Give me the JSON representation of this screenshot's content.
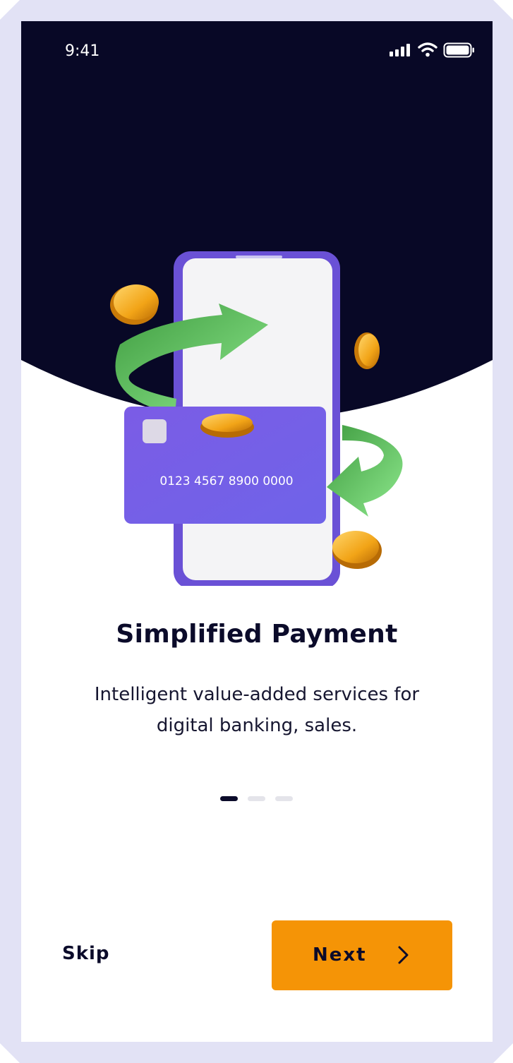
{
  "status_bar": {
    "time": "9:41",
    "icons": [
      "signal-icon",
      "wifi-icon",
      "battery-icon"
    ]
  },
  "illustration": {
    "card_number": "0123 4567 8900 0000",
    "icons": [
      "phone",
      "credit-card",
      "coin",
      "arrow-icon"
    ]
  },
  "onboarding": {
    "title": "Simplified Payment",
    "subtitle_line1": "Intelligent value-added services for",
    "subtitle_line2": "digital banking, sales.",
    "page_count": 3,
    "current_page": 1
  },
  "actions": {
    "skip_label": "Skip",
    "next_label": "Next",
    "next_icon": "chevron-right-icon"
  },
  "colors": {
    "header_background": "#080826",
    "accent": "#f59406",
    "text_dark": "#0b0b2a",
    "card_purple": "#7a5ee6",
    "arrow_green": "#54c35a"
  }
}
